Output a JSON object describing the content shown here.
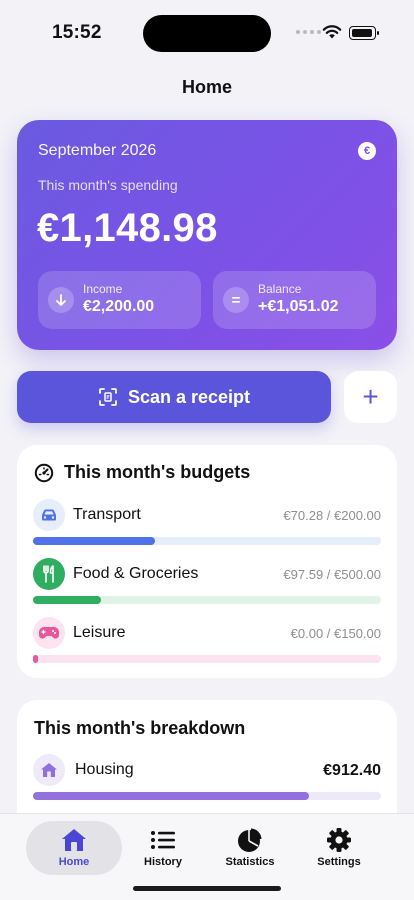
{
  "status": {
    "time": "15:52"
  },
  "nav": {
    "title": "Home"
  },
  "summary": {
    "month": "September 2026",
    "currency_symbol": "€",
    "spending_label": "This month's spending",
    "spending_amount": "€1,148.98",
    "income_label": "Income",
    "income_value": "€2,200.00",
    "balance_label": "Balance",
    "balance_value": "+€1,051.02",
    "balance_symbol": "="
  },
  "actions": {
    "scan_label": "Scan a receipt",
    "add_label": "+"
  },
  "budgets": {
    "title": "This month's budgets",
    "items": [
      {
        "name": "Transport",
        "amount": "€70.28 / €200.00",
        "progress": 0.351,
        "color": "#4f73e6",
        "track": "#e6edfb",
        "icon_bg": "#e6edfb",
        "icon": "car-icon"
      },
      {
        "name": "Food & Groceries",
        "amount": "€97.59 / €500.00",
        "progress": 0.195,
        "color": "#2fae62",
        "track": "#dff3e6",
        "icon_bg": "#2fae62",
        "icon": "utensils-icon"
      },
      {
        "name": "Leisure",
        "amount": "€0.00 / €150.00",
        "progress": 0.0,
        "color": "#e8579a",
        "track": "#fbe4ef",
        "icon_bg": "#fbe4ef",
        "icon": "gamepad-icon"
      }
    ]
  },
  "breakdown": {
    "title": "This month's breakdown",
    "items": [
      {
        "name": "Housing",
        "amount": "€912.40",
        "share": 0.794,
        "color": "#9371dd",
        "track": "#eee9f8",
        "icon": "house-icon"
      }
    ]
  },
  "tabs": [
    {
      "label": "Home",
      "icon": "house-icon",
      "active": true
    },
    {
      "label": "History",
      "icon": "list-icon",
      "active": false
    },
    {
      "label": "Statistics",
      "icon": "pie-chart-icon",
      "active": false
    },
    {
      "label": "Settings",
      "icon": "gear-icon",
      "active": false
    }
  ],
  "colors": {
    "accent": "#5b55dc",
    "card_gradient_start": "#6a5ae0",
    "card_gradient_end": "#8a4fe6"
  }
}
